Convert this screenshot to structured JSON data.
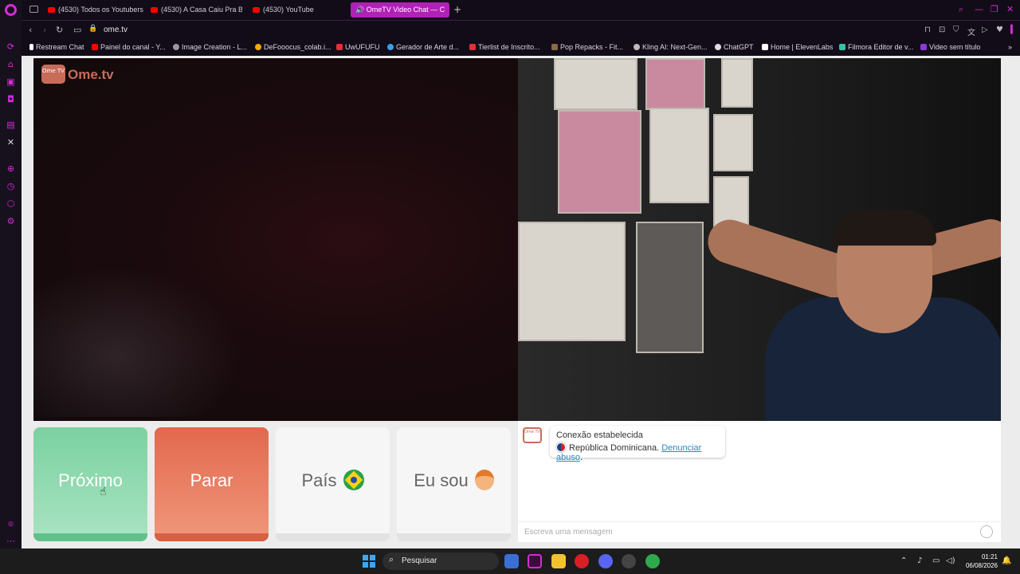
{
  "browser": {
    "tabs": [
      {
        "label": "(4530) Todos os Youtubers",
        "icon": "youtube-icon"
      },
      {
        "label": "(4530) A Casa Caiu Pra Bl",
        "icon": "youtube-icon"
      },
      {
        "label": "(4530) YouTube",
        "icon": "youtube-icon"
      },
      {
        "label": "OmeTV Video Chat — C",
        "icon": "speaker-icon",
        "active": true
      }
    ],
    "new_tab": "+",
    "url": "ome.tv",
    "accent_color": "#d62bd9"
  },
  "bookmarks": [
    {
      "label": "Restream Chat"
    },
    {
      "label": "Painel do canal - Y..."
    },
    {
      "label": "Image Creation - L..."
    },
    {
      "label": "DeFooocus_colab.i..."
    },
    {
      "label": "UwUFUFU"
    },
    {
      "label": "Gerador de Arte d..."
    },
    {
      "label": "Tierlist de Inscrito..."
    },
    {
      "label": "Pop Repacks - Fit..."
    },
    {
      "label": "Kling AI: Next-Gen..."
    },
    {
      "label": "ChatGPT"
    },
    {
      "label": "Home | ElevenLabs"
    },
    {
      "label": "Filmora Editor de v..."
    },
    {
      "label": "Video sem título"
    }
  ],
  "ometv": {
    "logo_text": "Ome.tv",
    "logo_badge": "Ome TV",
    "buttons": {
      "next": "Próximo",
      "stop": "Parar",
      "country": "País",
      "i_am": "Eu sou"
    },
    "chat": {
      "status": "Conexão estabelecida",
      "country": "República Dominicana.",
      "report_link": "Denunciar abuso",
      "report_suffix": ".",
      "input_placeholder": "Escreva uma mensagem"
    }
  },
  "taskbar": {
    "search_label": "Pesquisar",
    "time": "01:21",
    "date": "06/08/2026"
  }
}
